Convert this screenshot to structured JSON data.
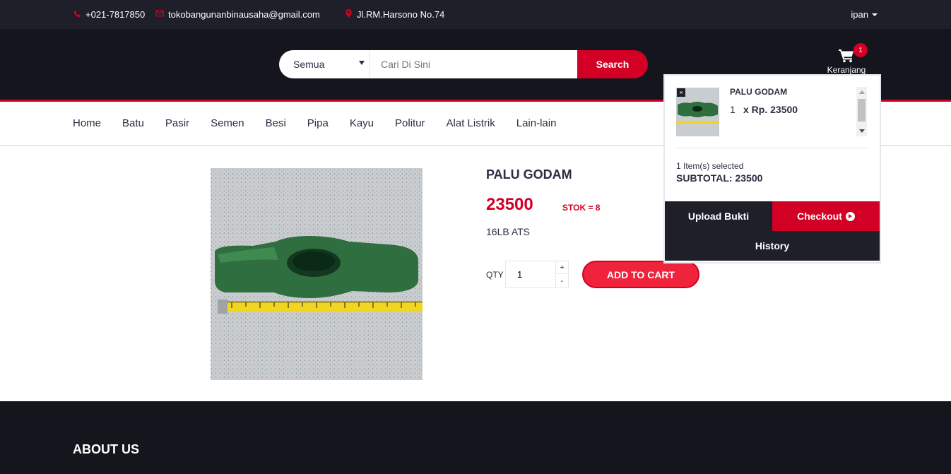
{
  "topbar": {
    "phone": "+021-7817850",
    "email": "tokobangunanbinausaha@gmail.com",
    "address": "Jl.RM.Harsono No.74",
    "user": "ipan"
  },
  "search": {
    "category": "Semua",
    "placeholder": "Cari Di Sini",
    "button": "Search"
  },
  "cart": {
    "label": "Keranjang",
    "count": "1"
  },
  "nav": {
    "items": [
      "Home",
      "Batu",
      "Pasir",
      "Semen",
      "Besi",
      "Pipa",
      "Kayu",
      "Politur",
      "Alat Listrik",
      "Lain-lain"
    ]
  },
  "product": {
    "name": "PALU GODAM",
    "price": "23500",
    "stock": "STOK = 8",
    "description": "16LB ATS",
    "qty_label": "QTY",
    "qty_value": "1",
    "qty_up": "+",
    "qty_down": "-",
    "add_to_cart": "ADD TO CART"
  },
  "dropdown": {
    "item_name": "PALU GODAM",
    "item_qty": "1",
    "item_price": "x Rp. 23500",
    "remove_icon": "×",
    "count_text": "1 Item(s) selected",
    "subtotal": "SUBTOTAL: 23500",
    "upload": "Upload Bukti",
    "checkout": "Checkout",
    "history": "History"
  },
  "footer": {
    "heading": "ABOUT US"
  },
  "colors": {
    "accent": "#d10024",
    "dark": "#15161d",
    "topbar": "#1e1f29"
  },
  "icons": [
    "phone-icon",
    "envelope-icon",
    "map-marker-icon",
    "shopping-cart-icon",
    "arrow-circle-right-icon",
    "remove-icon"
  ]
}
